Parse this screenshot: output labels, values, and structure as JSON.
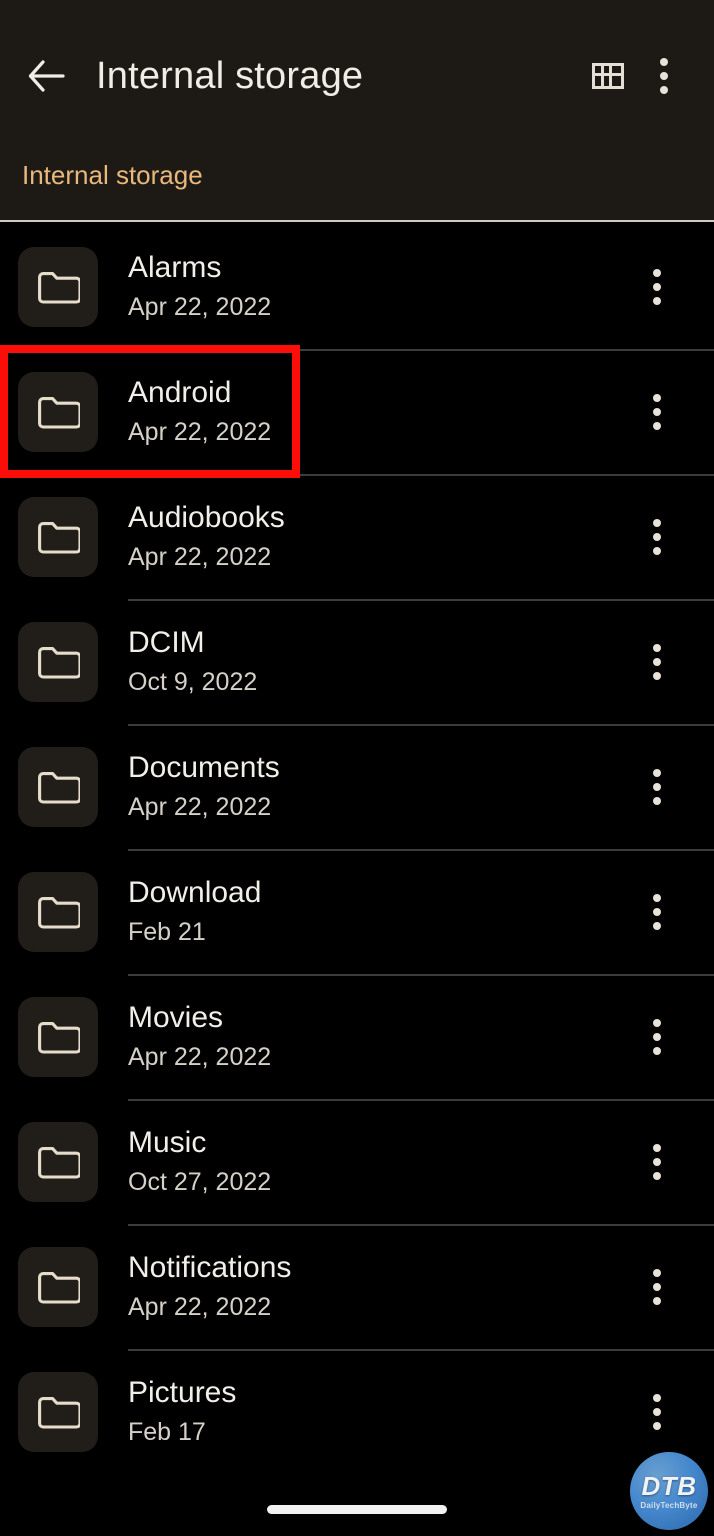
{
  "appbar": {
    "back_icon": "arrow-left-icon",
    "title": "Internal storage",
    "grid_view_icon": "grid-view-icon",
    "overflow_icon": "more-vert-icon"
  },
  "breadcrumb": {
    "items": [
      {
        "label": "Internal storage"
      }
    ],
    "accent_color": "#e8b87c"
  },
  "list": {
    "row_menu_icon": "more-vert-icon",
    "folder_icon": "folder-icon",
    "rows": [
      {
        "name": "Alarms",
        "date": "Apr 22, 2022"
      },
      {
        "name": "Android",
        "date": "Apr 22, 2022"
      },
      {
        "name": "Audiobooks",
        "date": "Apr 22, 2022"
      },
      {
        "name": "DCIM",
        "date": "Oct 9, 2022"
      },
      {
        "name": "Documents",
        "date": "Apr 22, 2022"
      },
      {
        "name": "Download",
        "date": "Feb 21"
      },
      {
        "name": "Movies",
        "date": "Apr 22, 2022"
      },
      {
        "name": "Music",
        "date": "Oct 27, 2022"
      },
      {
        "name": "Notifications",
        "date": "Apr 22, 2022"
      },
      {
        "name": "Pictures",
        "date": "Feb 17"
      }
    ]
  },
  "annotation": {
    "highlight_color": "#fb0d08",
    "target_row_index": 1
  },
  "watermark": {
    "main": "DTB",
    "sub": "DailyTechByte"
  },
  "colors": {
    "appbar_bg": "#1d1a16",
    "page_bg": "#000000",
    "tile_bg": "#211e1a",
    "primary_text": "#f2efe9",
    "secondary_text": "#d6d1c8",
    "divider": "#3c3c3c"
  }
}
